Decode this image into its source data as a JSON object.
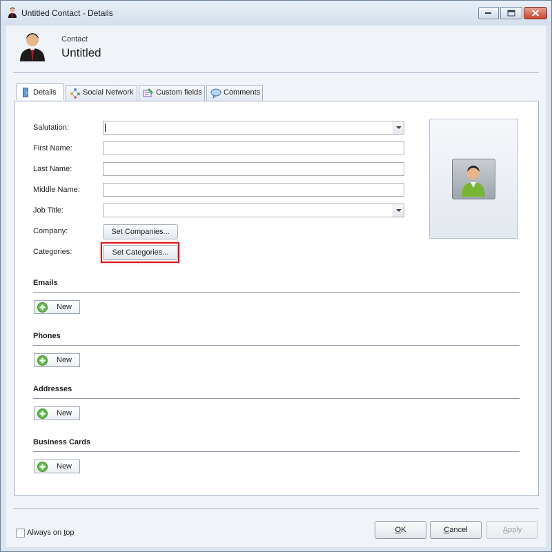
{
  "window": {
    "title": "Untitled Contact - Details",
    "close_color": "#c8452e"
  },
  "header": {
    "type_label": "Contact",
    "name": "Untitled"
  },
  "tabs": [
    {
      "label": "Details",
      "icon": "door-icon",
      "active": true
    },
    {
      "label": "Social Network",
      "icon": "social-network-icon",
      "active": false
    },
    {
      "label": "Custom fields",
      "icon": "custom-fields-icon",
      "active": false
    },
    {
      "label": "Comments",
      "icon": "comment-bubble-icon",
      "active": false
    }
  ],
  "form": {
    "salutation": {
      "label": "Salutation:",
      "value": ""
    },
    "first_name": {
      "label": "First Name:",
      "value": ""
    },
    "last_name": {
      "label": "Last Name:",
      "value": ""
    },
    "middle_name": {
      "label": "Middle Name:",
      "value": ""
    },
    "job_title": {
      "label": "Job Title:",
      "value": ""
    },
    "company": {
      "label": "Company:",
      "button": "Set Companies..."
    },
    "categories": {
      "label": "Categories:",
      "button": "Set Categories..."
    }
  },
  "sections": [
    {
      "title": "Emails",
      "new_label": "New"
    },
    {
      "title": "Phones",
      "new_label": "New"
    },
    {
      "title": "Addresses",
      "new_label": "New"
    },
    {
      "title": "Business Cards",
      "new_label": "New"
    }
  ],
  "footer": {
    "always_on_top": {
      "pre": "Always on ",
      "underlined": "t",
      "post": "op",
      "checked": false
    },
    "ok": {
      "underlined": "O",
      "rest": "K"
    },
    "cancel": {
      "underlined": "C",
      "rest": "ancel"
    },
    "apply": {
      "underlined": "A",
      "rest": "pply",
      "disabled": true
    }
  },
  "highlight_color": "#d9121b"
}
